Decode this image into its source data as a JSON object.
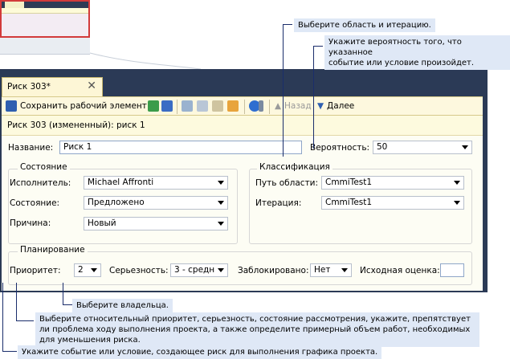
{
  "tab": {
    "title": "Риск 303*",
    "close": "✕"
  },
  "toolbar": {
    "save_label": "Сохранить рабочий элемент",
    "back_label": "Назад",
    "forward_label": "Далее"
  },
  "header": {
    "title": "Риск 303 (измененный): риск 1"
  },
  "form": {
    "name_label": "Название:",
    "name_value": "Риск 1",
    "probability_label": "Вероятность:",
    "probability_value": "50",
    "state_group": "Состояние",
    "assigned_label": "Исполнитель:",
    "assigned_value": "Michael Affronti",
    "status_label": "Состояние:",
    "status_value": "Предложено",
    "reason_label": "Причина:",
    "reason_value": "Новый",
    "class_group": "Классификация",
    "area_label": "Путь области:",
    "area_value": "CmmiTest1",
    "iteration_label": "Итерация:",
    "iteration_value": "CmmiTest1",
    "planning_group": "Планирование",
    "priority_label": "Приоритет:",
    "priority_value": "2",
    "severity_label": "Серьезность:",
    "severity_value": "3 - средн",
    "blocked_label": "Заблокировано:",
    "blocked_value": "Нет",
    "estimate_label": "Исходная оценка:",
    "estimate_value": ""
  },
  "callouts": {
    "area": "Выберите область и итерацию.",
    "probability": "Укажите вероятность того, что указанное\nсобытие или условие произойдет.",
    "owner": "Выберите владельца.",
    "planning": "Выберите относительный приоритет, серьезность, состояние рассмотрения, укажите, препятствует\nли проблема ходу выполнения проекта, а также определите примерный объем работ, необходимых\nдля уменьшения риска.",
    "title": "Укажите событие или условие, создающее риск для выполнения графика проекта."
  },
  "colors": {
    "frame": "#2b3a56",
    "toolbar": "#fdf8de",
    "callout_bg": "#dfe8f6",
    "callout_line": "#1a2d6b"
  }
}
